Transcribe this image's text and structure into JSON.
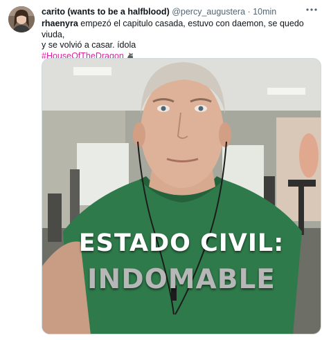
{
  "tweet": {
    "display_name": "carito (wants to be a halfblood)",
    "handle": "@percy_augustera",
    "separator": "·",
    "time": "10min",
    "more_icon": "more-horizontal-icon",
    "text_bold": "rhaenyra",
    "text_line1_rest": " empezó el capitulo casada, estuvo con daemon, se quedo viuda,",
    "text_line2": "y se volvió a casar. ídola",
    "hashtag": "#HouseOfTheDragon",
    "hashtag_emoji": "dragon-emoji-icon",
    "hashtag_color": "#d6249f"
  },
  "media": {
    "caption_line1": "ESTADO CIVIL:",
    "caption_line2": "INDOMABLE"
  }
}
